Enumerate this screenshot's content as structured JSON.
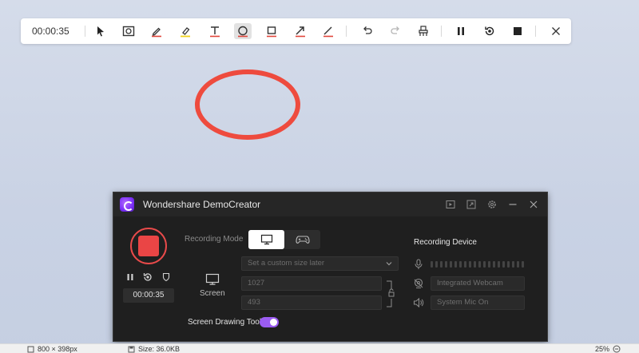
{
  "toolbar": {
    "time": "00:00:35",
    "tools": [
      {
        "name": "cursor-tool",
        "icon": "cursor-arrow-icon"
      },
      {
        "name": "screenshot-tool",
        "icon": "frame-icon"
      },
      {
        "name": "pen-tool",
        "icon": "pencil-icon"
      },
      {
        "name": "highlighter-tool",
        "icon": "highlighter-icon"
      },
      {
        "name": "text-tool",
        "icon": "text-icon"
      },
      {
        "name": "ellipse-tool",
        "icon": "circle-icon"
      },
      {
        "name": "rectangle-tool",
        "icon": "square-icon"
      },
      {
        "name": "arrow-tool",
        "icon": "arrow-icon"
      },
      {
        "name": "line-tool",
        "icon": "line-icon"
      },
      {
        "name": "undo",
        "icon": "undo-icon"
      },
      {
        "name": "redo",
        "icon": "redo-icon"
      },
      {
        "name": "eraser",
        "icon": "eraser-icon"
      },
      {
        "name": "pause",
        "icon": "pause-icon"
      },
      {
        "name": "restart",
        "icon": "restart-icon"
      },
      {
        "name": "stop",
        "icon": "stop-icon"
      },
      {
        "name": "close",
        "icon": "close-icon"
      }
    ],
    "active_tool": "ellipse-tool"
  },
  "annotation": {
    "shape": "ellipse",
    "color": "#ee4b3e"
  },
  "window": {
    "title": "Wondershare DemoCreator",
    "title_controls": [
      "presentation-icon",
      "resize-icon",
      "settings-icon",
      "minimize-icon",
      "close-icon"
    ],
    "timer": "00:00:35",
    "recording_mode_label": "Recording Mode",
    "modes": [
      {
        "name": "screen",
        "icon": "monitor-icon",
        "active": true
      },
      {
        "name": "game",
        "icon": "gamepad-icon",
        "active": false
      }
    ],
    "capture_area_label": "Screen",
    "size_dropdown": "Set a custom size later",
    "width": "1027",
    "height": "493",
    "screen_drawing_label": "Screen Drawing Tool",
    "screen_drawing_enabled": true,
    "recording_device_title": "Recording Device",
    "webcam_value": "Integrated Webcam",
    "mic_value": "System Mic On",
    "accent_color": "#9b5cf2",
    "record_color": "#ea4545"
  },
  "statusbar": {
    "dimensions": "800 × 398px",
    "size": "Size: 36.0KB",
    "zoom": "25%"
  }
}
